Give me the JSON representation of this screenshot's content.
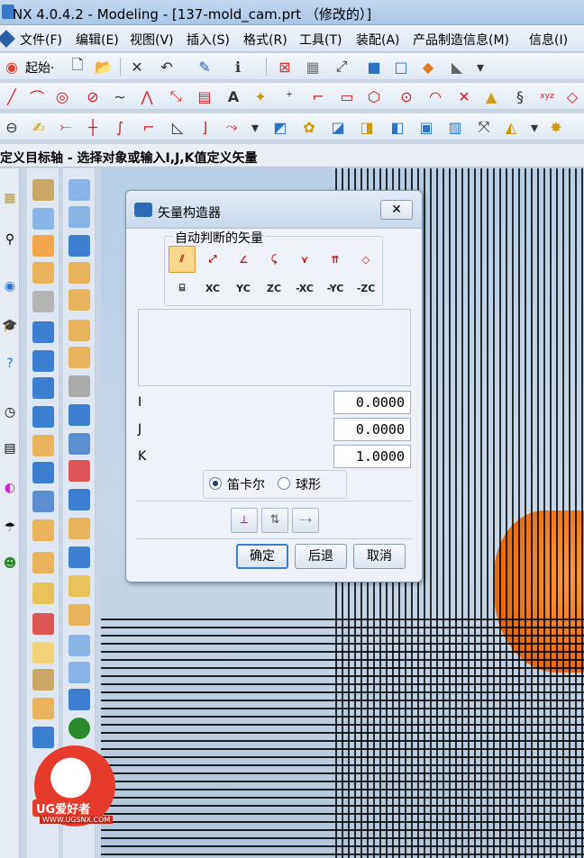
{
  "window": {
    "title": "NX 4.0.4.2 - Modeling - [137-mold_cam.prt （修改的）]"
  },
  "menu": {
    "items": [
      {
        "label": "文件(F)"
      },
      {
        "label": "编辑(E)"
      },
      {
        "label": "视图(V)"
      },
      {
        "label": "插入(S)"
      },
      {
        "label": "格式(R)"
      },
      {
        "label": "工具(T)"
      },
      {
        "label": "装配(A)"
      },
      {
        "label": "产品制造信息(M)"
      },
      {
        "label": "信息(I)"
      }
    ]
  },
  "toolbar": {
    "start_label": "起始·"
  },
  "prompt": {
    "text": "定义目标轴 - 选择对象或输入I,J,K值定义矢量"
  },
  "dialog": {
    "title": "矢量构造器",
    "group_label": "自动判断的矢量",
    "vector_buttons_row2": [
      "XC",
      "YC",
      "ZC",
      "-XC",
      "-YC",
      "-ZC"
    ],
    "fields": [
      {
        "label": "I",
        "value": "0.0000"
      },
      {
        "label": "J",
        "value": "0.0000"
      },
      {
        "label": "K",
        "value": "1.0000"
      }
    ],
    "radio_cartesian": "笛卡尔",
    "radio_spherical": "球形",
    "radio_selected": "笛卡尔",
    "ok_label": "确定",
    "back_label": "后退",
    "cancel_label": "取消"
  },
  "logo": {
    "name": "UG爱好者",
    "url": "WWW.UGSNX.COM"
  },
  "colors": {
    "accent_orange": "#e56a10",
    "active_button": "#fbd98c"
  }
}
